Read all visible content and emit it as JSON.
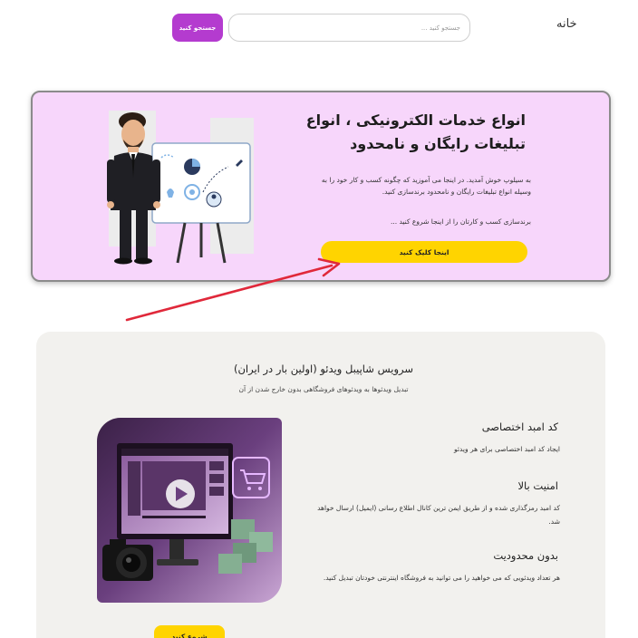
{
  "header": {
    "home_label": "خانه",
    "search_placeholder": "جستجو کنید ...",
    "search_button_label": "جستجو کنید"
  },
  "hero": {
    "title": "انواع خدمات الکترونیکی ، انواع تبلیغات رایگان و نامحدود",
    "description": "به سیلوپ خوش آمدید. در اینجا می آموزید که چگونه کسب و کار خود را به وسیله انواع تبلیغات رایگان و نامحدود برندسازی کنید.",
    "description_2": "برندسازی کسب و کارتان را از اینجا شروع کنید ...",
    "cta_label": "اینجا کلیک کنید",
    "background_color": "#f7d6fb",
    "cta_color": "#ffd400"
  },
  "services": {
    "title": "سرویس شاپیبل ویدئو (اولین بار در ایران)",
    "subtitle": "تبدیل ویدئوها به ویدئوهای فروشگاهی بدون خارج شدن از آن",
    "features": [
      {
        "title": "کد امبد اختصاصی",
        "description": "ایجاد کد امبد اختصاصی برای هر ویدئو"
      },
      {
        "title": "امنیت بالا",
        "description": "کد امبد رمزگذاری شده و از طریق ایمن ترین کانال اطلاع رسانی (ایمیل) ارسال خواهد شد."
      },
      {
        "title": "بدون محدودیت",
        "description": "هر تعداد ویدئویی که می خواهید را می توانید به فروشگاه اینترنتی خودتان تبدیل کنید."
      }
    ],
    "cta_label": "شروع کنید"
  },
  "colors": {
    "accent_purple": "#b43bcf",
    "accent_yellow": "#ffd400",
    "arrow_red": "#e0283a",
    "card_background": "#f2f1ee"
  }
}
